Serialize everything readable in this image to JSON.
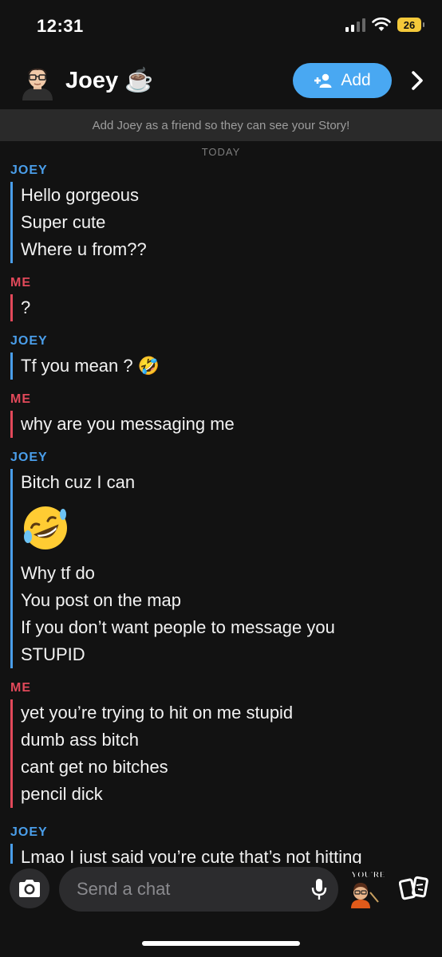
{
  "status_bar": {
    "time": "12:31",
    "battery": "26"
  },
  "header": {
    "name": "Joey ☕",
    "add_label": "Add"
  },
  "banner": "Add Joey as a friend so they can see your Story!",
  "date_divider": "TODAY",
  "messages": {
    "g1": {
      "sender": "JOEY",
      "lines": [
        "Hello gorgeous",
        "Super cute",
        "Where u from??"
      ]
    },
    "g2": {
      "sender": "ME",
      "lines": [
        "?"
      ]
    },
    "g3": {
      "sender": "JOEY",
      "lines": [
        "Tf you mean ? 🤣"
      ]
    },
    "g4": {
      "sender": "ME",
      "lines": [
        "why are you messaging me"
      ]
    },
    "g5": {
      "sender": "JOEY",
      "lines": [
        "Bitch cuz I can",
        "Why tf do",
        "You post on the map",
        "If you don’t want people to message you",
        "STUPID"
      ]
    },
    "g6": {
      "sender": "ME",
      "lines": [
        "yet you’re trying to hit on me stupid",
        "dumb ass bitch",
        "cant get no bitches",
        "pencil dick"
      ]
    },
    "g7": {
      "sender": "JOEY",
      "lines": [
        "Lmao I just said you’re cute that’s not hitting"
      ]
    }
  },
  "composer": {
    "placeholder": "Send a chat",
    "sticker_text": "YOU'RE"
  },
  "colors": {
    "joey": "#4a9eea",
    "me": "#e2495a",
    "add_button": "#49a8f2",
    "background": "#121212"
  },
  "icons": [
    "signal-icon",
    "wifi-icon",
    "battery-icon",
    "avatar",
    "add-friend-icon",
    "chevron-right-icon",
    "laughing-emoji",
    "camera-icon",
    "microphone-icon",
    "sticker",
    "cards-icon"
  ]
}
